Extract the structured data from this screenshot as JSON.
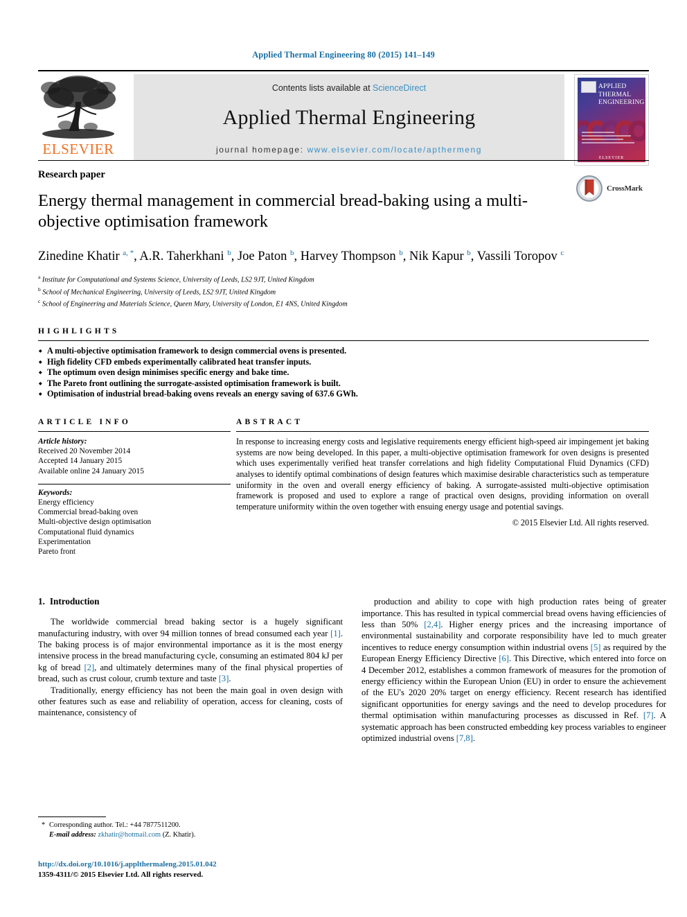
{
  "running_head": "Applied Thermal Engineering 80 (2015) 141–149",
  "masthead": {
    "publisher": "ELSEVIER",
    "contents_prefix": "Contents lists available at ",
    "contents_link": "ScienceDirect",
    "journal_name": "Applied Thermal Engineering",
    "homepage_prefix": "journal homepage: ",
    "homepage_url": "www.elsevier.com/locate/apthermeng",
    "cover": {
      "line1": "APPLIED",
      "line2": "THERMAL",
      "line3": "ENGINEERING",
      "brand": "ELSEVIER"
    }
  },
  "article": {
    "kind": "Research paper",
    "title": "Energy thermal management in commercial bread-baking using a multi-objective optimisation framework",
    "authors_html": "Zinedine Khatir <sup>a, *</sup>, A.R. Taherkhani <sup>b</sup>, Joe Paton <sup>b</sup>, Harvey Thompson <sup>b</sup>, Nik Kapur <sup>b</sup>, Vassili Toropov <sup>c</sup>",
    "affiliations": [
      {
        "marker": "a",
        "text": "Institute for Computational and Systems Science, University of Leeds, LS2 9JT, United Kingdom"
      },
      {
        "marker": "b",
        "text": "School of Mechanical Engineering, University of Leeds, LS2 9JT, United Kingdom"
      },
      {
        "marker": "c",
        "text": "School of Engineering and Materials Science, Queen Mary, University of London, E1 4NS, United Kingdom"
      }
    ],
    "crossmark_label": "CrossMark"
  },
  "highlights": {
    "heading": "HIGHLIGHTS",
    "items": [
      "A multi-objective optimisation framework to design commercial ovens is presented.",
      "High fidelity CFD embeds experimentally calibrated heat transfer inputs.",
      "The optimum oven design minimises specific energy and bake time.",
      "The Pareto front outlining the surrogate-assisted optimisation framework is built.",
      "Optimisation of industrial bread-baking ovens reveals an energy saving of 637.6 GWh."
    ]
  },
  "article_info": {
    "heading": "ARTICLE INFO",
    "history_label": "Article history:",
    "history": [
      "Received 20 November 2014",
      "Accepted 14 January 2015",
      "Available online 24 January 2015"
    ],
    "keywords_label": "Keywords:",
    "keywords": [
      "Energy efficiency",
      "Commercial bread-baking oven",
      "Multi-objective design optimisation",
      "Computational fluid dynamics",
      "Experimentation",
      "Pareto front"
    ]
  },
  "abstract": {
    "heading": "ABSTRACT",
    "text": "In response to increasing energy costs and legislative requirements energy efficient high-speed air impingement jet baking systems are now being developed. In this paper, a multi-objective optimisation framework for oven designs is presented which uses experimentally verified heat transfer correlations and high fidelity Computational Fluid Dynamics (CFD) analyses to identify optimal combinations of design features which maximise desirable characteristics such as temperature uniformity in the oven and overall energy efficiency of baking. A surrogate-assisted multi-objective optimisation framework is proposed and used to explore a range of practical oven designs, providing information on overall temperature uniformity within the oven together with ensuing energy usage and potential savings.",
    "copyright": "© 2015 Elsevier Ltd. All rights reserved."
  },
  "introduction": {
    "number": "1.",
    "heading": "Introduction",
    "left_paragraphs": [
      "The worldwide commercial bread baking sector is a hugely significant manufacturing industry, with over 94 million tonnes of bread consumed each year [1]. The baking process is of major environmental importance as it is the most energy intensive process in the bread manufacturing cycle, consuming an estimated 804 kJ per kg of bread [2], and ultimately determines many of the final physical properties of bread, such as crust colour, crumb texture and taste [3].",
      "Traditionally, energy efficiency has not been the main goal in oven design with other features such as ease and reliability of operation, access for cleaning, costs of maintenance, consistency of"
    ],
    "right_paragraphs": [
      "production and ability to cope with high production rates being of greater importance. This has resulted in typical commercial bread ovens having efficiencies of less than 50% [2,4]. Higher energy prices and the increasing importance of environmental sustainability and corporate responsibility have led to much greater incentives to reduce energy consumption within industrial ovens [5] as required by the European Energy Efficiency Directive [6]. This Directive, which entered into force on 4 December 2012, establishes a common framework of measures for the promotion of energy efficiency within the European Union (EU) in order to ensure the achievement of the EU's 2020 20% target on energy efficiency. Recent research has identified significant opportunities for energy savings and the need to develop procedures for thermal optimisation within manufacturing processes as discussed in Ref. [7]. A systematic approach has been constructed embedding key process variables to engineer optimized industrial ovens [7,8]."
    ]
  },
  "footnote": {
    "corresponding": "Corresponding author. Tel.: +44 7877511200.",
    "email_label": "E-mail address:",
    "email": "zkhatir@hotmail.com",
    "email_suffix": "(Z. Khatir)."
  },
  "imprint": {
    "doi": "http://dx.doi.org/10.1016/j.applthermaleng.2015.01.042",
    "issn_line": "1359-4311/© 2015 Elsevier Ltd. All rights reserved."
  },
  "colors": {
    "link_blue": "#1a6fa3",
    "sd_blue": "#3a8fc4",
    "elsevier_orange": "#F06F20"
  }
}
